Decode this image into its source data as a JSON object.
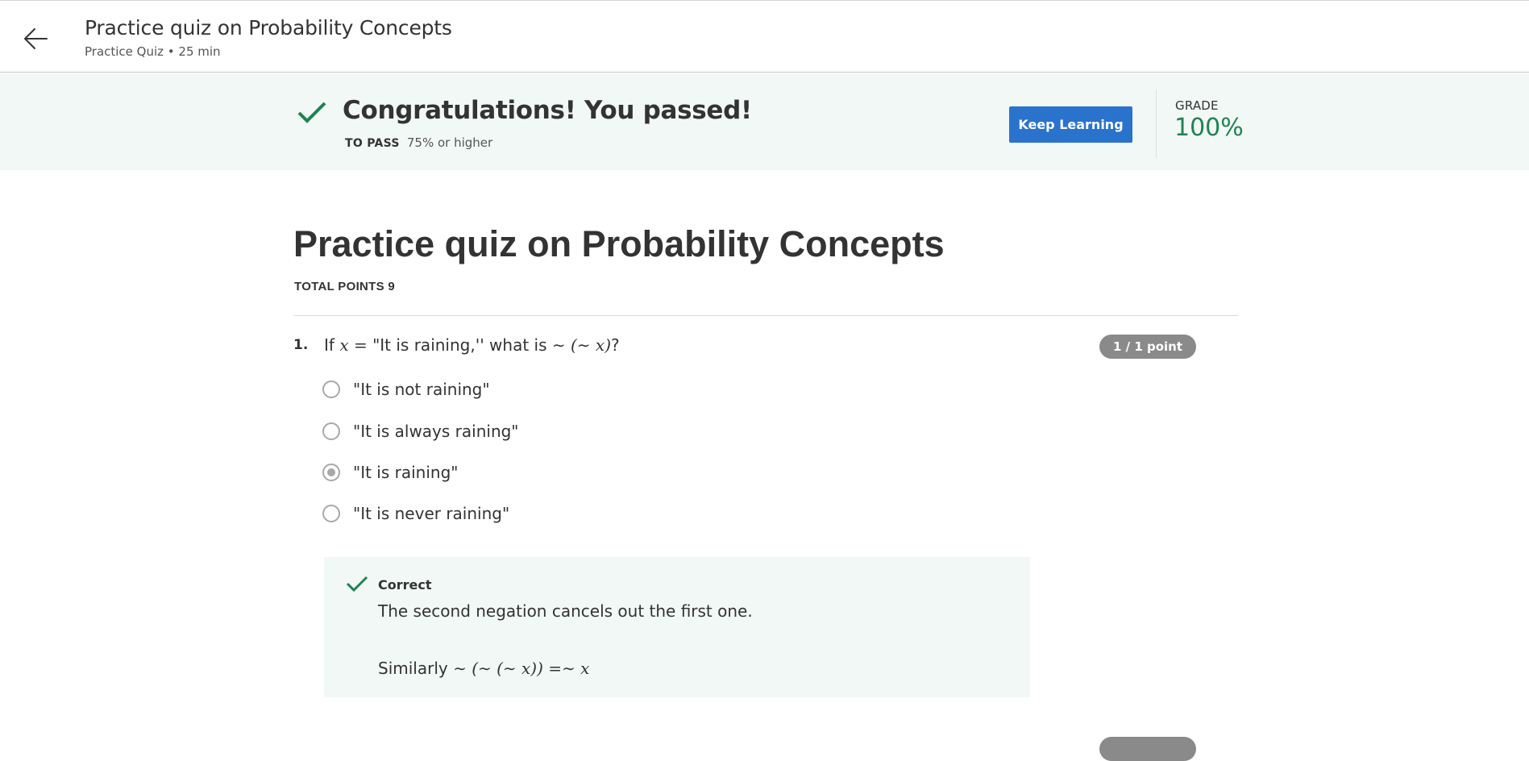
{
  "header": {
    "title": "Practice quiz on Probability Concepts",
    "subtitle": "Practice Quiz • 25 min",
    "back_icon": "arrow-left-icon"
  },
  "result": {
    "message": "Congratulations! You passed!",
    "to_pass_label": "TO PASS",
    "to_pass_value": "75% or higher",
    "button_label": "Keep Learning",
    "grade_label": "GRADE",
    "grade_value": "100%",
    "success_color": "#1f8354",
    "button_color": "#2a73cc"
  },
  "quiz": {
    "title": "Practice quiz on Probability Concepts",
    "total_points": "TOTAL POINTS 9"
  },
  "questions": [
    {
      "number": "1.",
      "text_prefix": "If",
      "math_x": "x",
      "math_eq": "=",
      "text_middle": "\"It is raining,'' what is",
      "math_expr": "∼ (∼ x)",
      "text_suffix": "?",
      "points": "1 / 1 point",
      "options": [
        {
          "label": "\"It is not raining\"",
          "selected": false
        },
        {
          "label": "\"It is always raining\"",
          "selected": false
        },
        {
          "label": "\"It is raining\"",
          "selected": true
        },
        {
          "label": "\"It is never raining\"",
          "selected": false
        }
      ],
      "feedback": {
        "status": "Correct",
        "text": "The second negation cancels out the first one.",
        "similar_prefix": "Similarly",
        "similar_math": "∼ (∼ (∼ x)) =∼ x"
      }
    }
  ]
}
